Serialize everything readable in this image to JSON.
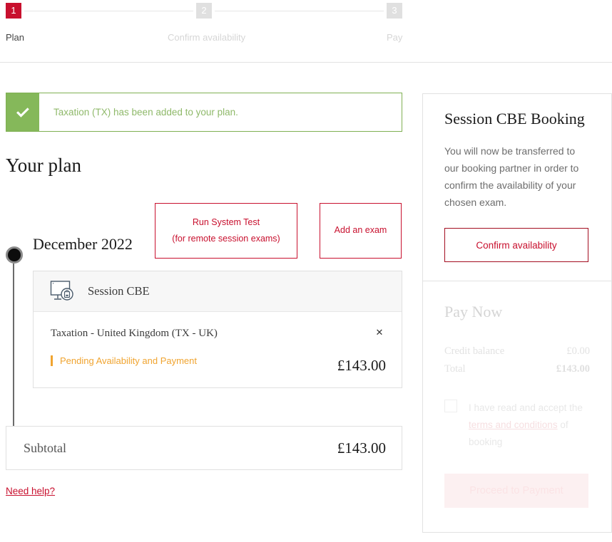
{
  "stepper": {
    "steps": [
      {
        "number": "1",
        "label": "Plan",
        "state": "active"
      },
      {
        "number": "2",
        "label": "Confirm availability",
        "state": "inactive"
      },
      {
        "number": "3",
        "label": "Pay",
        "state": "inactive"
      }
    ],
    "active_color": "#c8102e",
    "inactive_color": "#e0e0e0"
  },
  "alert": {
    "icon": "check-icon",
    "message": "Taxation (TX) has been added to your plan.",
    "border_color": "#7fb053",
    "icon_bg": "#85b85a",
    "text_color": "#8fb96a"
  },
  "plan": {
    "title": "Your plan",
    "run_system_test_line1": "Run System Test",
    "run_system_test_line2": "(for remote session exams)",
    "add_exam_label": "Add an exam",
    "accent_color": "#c8102e"
  },
  "timeline": {
    "month": "December 2022"
  },
  "exam_card": {
    "type_label": "Session CBE",
    "type_icon": "monitor-exam-icon",
    "exam_name": "Taxation - United Kingdom (TX - UK)",
    "remove_icon": "close-icon",
    "status": "Pending Availability and Payment",
    "status_color": "#f0a430",
    "price": "£143.00"
  },
  "subtotal": {
    "label": "Subtotal",
    "value": "£143.00"
  },
  "footer": {
    "need_help_label": "Need help?"
  },
  "sidebar": {
    "booking": {
      "title": "Session CBE Booking",
      "body": "You will now be transferred to our booking partner in order to confirm the availability of your chosen exam.",
      "confirm_label": "Confirm availability"
    },
    "pay_now": {
      "title": "Pay Now",
      "credit_balance_label": "Credit balance",
      "credit_balance_value": "£0.00",
      "total_label": "Total",
      "total_value": "£143.00",
      "terms_text_before": "I have read and accept the ",
      "terms_link": "terms and conditions",
      "terms_text_after": " of booking",
      "proceed_label": "Proceed to Payment",
      "disabled": true
    }
  }
}
